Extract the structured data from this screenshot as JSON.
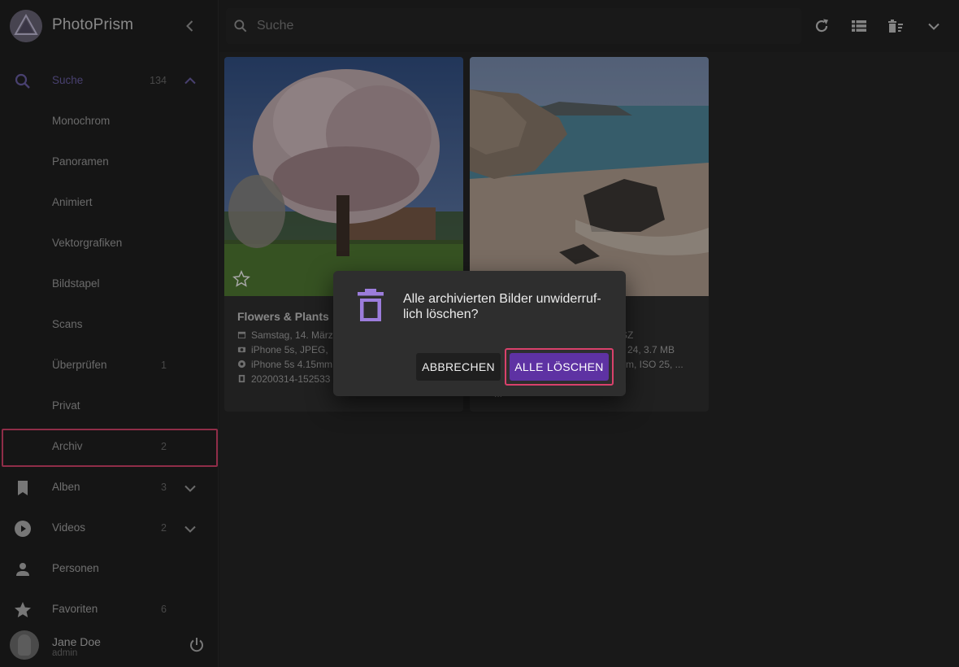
{
  "sidebar": {
    "brand_title": "PhotoPrism",
    "items": [
      {
        "label": "Suche",
        "count": "134"
      },
      {
        "label": "Monochrom",
        "count": ""
      },
      {
        "label": "Panoramen",
        "count": ""
      },
      {
        "label": "Animiert",
        "count": ""
      },
      {
        "label": "Vektorgrafiken",
        "count": ""
      },
      {
        "label": "Bildstapel",
        "count": ""
      },
      {
        "label": "Scans",
        "count": ""
      },
      {
        "label": "Überprüfen",
        "count": "1"
      },
      {
        "label": "Privat",
        "count": ""
      },
      {
        "label": "Archiv",
        "count": "2"
      },
      {
        "label": "Alben",
        "count": "3"
      },
      {
        "label": "Videos",
        "count": "2"
      },
      {
        "label": "Personen",
        "count": ""
      },
      {
        "label": "Favoriten",
        "count": "6"
      }
    ],
    "user": {
      "name": "Jane Doe",
      "role": "admin"
    }
  },
  "search": {
    "placeholder": "Suche"
  },
  "cards": [
    {
      "title": "Flowers & Plants",
      "meta": [
        "Samstag, 14. März",
        "iPhone 5s, JPEG,",
        "iPhone 5s 4.15mm",
        "20200314-152533"
      ]
    },
    {
      "title": "",
      "meta": [
        "SZ",
        "24, 3.7 MB",
        "mm, ISO 25, ...",
        "..."
      ]
    }
  ],
  "dialog": {
    "text": "Alle archivierten Bilder unwiderruf-lich löschen?",
    "cancel_label": "ABBRECHEN",
    "confirm_label": "ALLE LÖSCHEN"
  },
  "colors": {
    "accent": "#6b5fa8",
    "confirm": "#5e32a3",
    "highlight": "#d9416b"
  }
}
